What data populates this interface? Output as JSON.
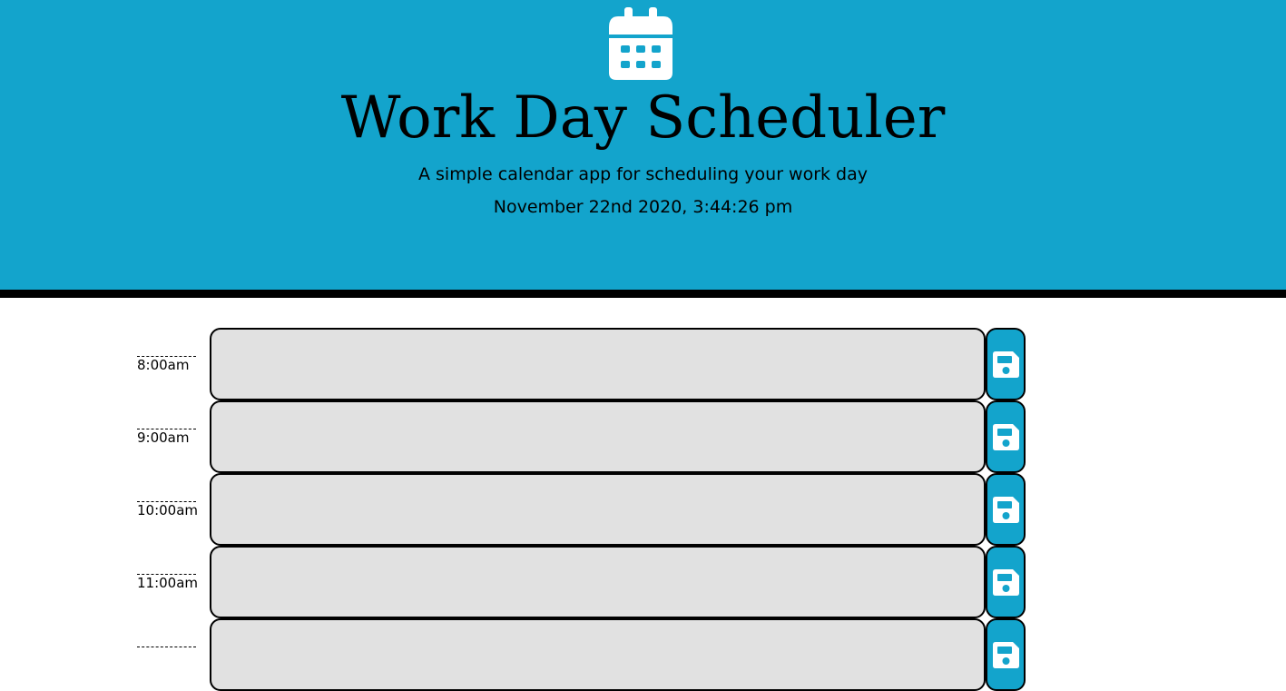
{
  "header": {
    "icon": "calendar-icon",
    "title": "Work Day Scheduler",
    "subtitle": "A simple calendar app for scheduling your work day",
    "datetime": "November 22nd 2020, 3:44:26 pm"
  },
  "schedule": {
    "rows": [
      {
        "hour": "8:00am",
        "event": "",
        "save_icon": "floppy-disk-icon"
      },
      {
        "hour": "9:00am",
        "event": "",
        "save_icon": "floppy-disk-icon"
      },
      {
        "hour": "10:00am",
        "event": "",
        "save_icon": "floppy-disk-icon"
      },
      {
        "hour": "11:00am",
        "event": "",
        "save_icon": "floppy-disk-icon"
      },
      {
        "hour": "",
        "event": "",
        "save_icon": "floppy-disk-icon"
      }
    ]
  },
  "colors": {
    "header_background": "#13a4cc",
    "header_border": "#000000",
    "event_background": "#e1e1e1",
    "save_button": "#13a4cc",
    "icon_color": "#ffffff"
  }
}
